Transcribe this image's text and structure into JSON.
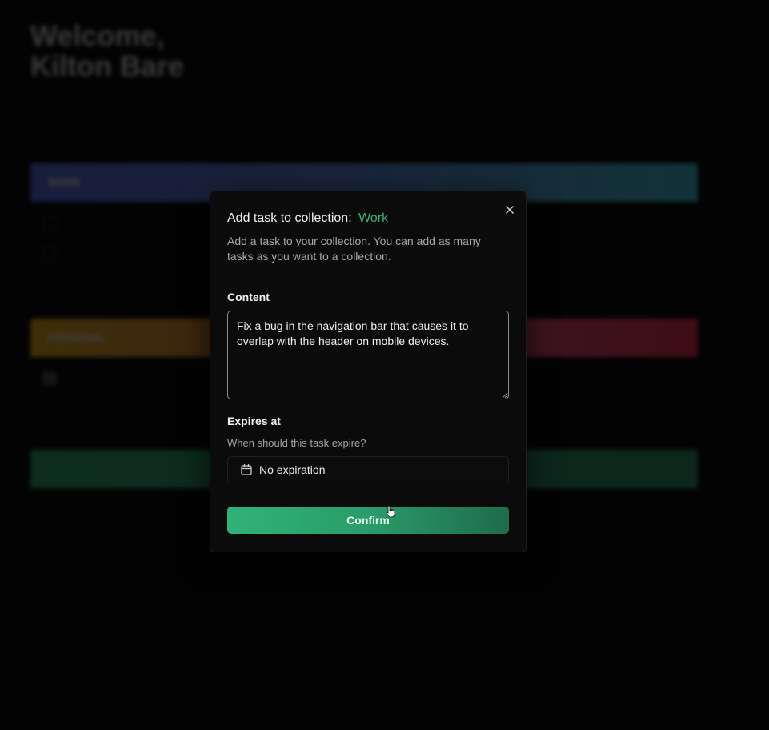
{
  "background": {
    "welcome_line1": "Welcome,",
    "welcome_line2": "Kilton Bare",
    "collections": [
      {
        "name": "WORK",
        "color": "#4f63d6"
      },
      {
        "name": "PERSONAL",
        "color": "#d9a51b"
      },
      {
        "name": "",
        "color": "#2aa06a"
      }
    ]
  },
  "dialog": {
    "title": "Add task to collection:",
    "collection_name": "Work",
    "collection_color": "#3cb27a",
    "description": "Add a task to your collection. You can add as many tasks as you want to a collection.",
    "content_label": "Content",
    "content_value": "Fix a bug in the navigation bar that causes it to overlap with the header on mobile devices.",
    "expires_label": "Expires at",
    "expires_hint": "When should this task expire?",
    "expires_value": "No expiration",
    "confirm_label": "Confirm",
    "close_icon": "close-icon",
    "calendar_icon": "calendar-icon"
  }
}
